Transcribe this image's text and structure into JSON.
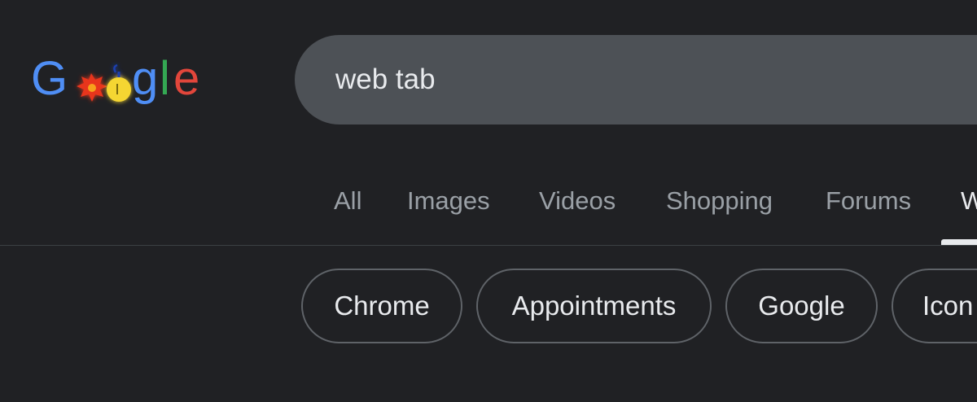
{
  "logo": {
    "letters": [
      "G",
      "o",
      "o",
      "g",
      "l",
      "e"
    ],
    "colors": {
      "blue": "#4f8ef5",
      "red": "#e2463b",
      "yellow": "#f7d21f",
      "green": "#34a853",
      "doodle_red": "#e8341c",
      "doodle_yellow": "#f5d633"
    }
  },
  "search": {
    "query": "web tab"
  },
  "tabs": [
    {
      "label": "All",
      "active": false
    },
    {
      "label": "Images",
      "active": false
    },
    {
      "label": "Videos",
      "active": false
    },
    {
      "label": "Shopping",
      "active": false
    },
    {
      "label": "Forums",
      "active": false
    },
    {
      "label": "W",
      "active": true
    }
  ],
  "chips": [
    {
      "label": "Chrome"
    },
    {
      "label": "Appointments"
    },
    {
      "label": "Google"
    },
    {
      "label": "Icon"
    }
  ],
  "colors": {
    "background": "#202124",
    "searchbox": "#4d5156",
    "text": "#e8eaed",
    "muted_text": "#9aa0a6",
    "chip_border": "#5f6368"
  }
}
